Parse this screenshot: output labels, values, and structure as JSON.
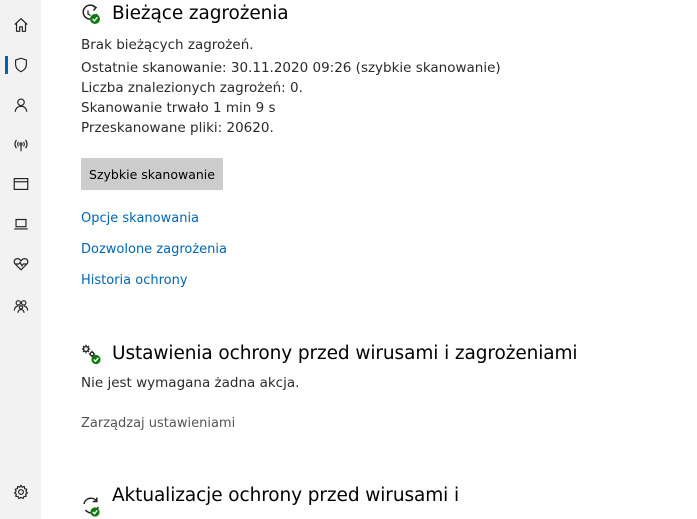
{
  "colors": {
    "accent": "#0063b1",
    "link": "#0066b4",
    "sidebar_bg": "#f2f2f2",
    "button_bg": "#cccccc",
    "status_ok": "#107c10"
  },
  "sidebar": {
    "items": [
      {
        "icon": "home-icon"
      },
      {
        "icon": "shield-icon",
        "active": true
      },
      {
        "icon": "person-icon"
      },
      {
        "icon": "wireless-icon"
      },
      {
        "icon": "app-browser-icon"
      },
      {
        "icon": "laptop-icon"
      },
      {
        "icon": "heart-icon"
      },
      {
        "icon": "family-icon"
      },
      {
        "icon": "gear-icon"
      }
    ]
  },
  "current_threats": {
    "icon": "scan-refresh-check-icon",
    "title": "Bieżące zagrożenia",
    "status": "Brak bieżących zagrożeń.",
    "last_scan": "Ostatnie skanowanie: 30.11.2020 09:26 (szybkie skanowanie)",
    "threats_found": "Liczba znalezionych zagrożeń: 0.",
    "scan_duration": "Skanowanie trwało 1 min 9 s",
    "files_scanned": "Przeskanowane pliki: 20620.",
    "quick_scan_label": "Szybkie skanowanie",
    "links": {
      "scan_options": "Opcje skanowania",
      "allowed_threats": "Dozwolone zagrożenia",
      "protection_history": "Historia ochrony"
    }
  },
  "protection_settings": {
    "icon": "gears-check-icon",
    "title": "Ustawienia ochrony przed wirusami i zagrożeniami",
    "status": "Nie jest wymagana żadna akcja.",
    "manage_label": "Zarządzaj ustawieniami"
  },
  "protection_updates": {
    "icon": "update-check-icon",
    "title": "Aktualizacje ochrony przed wirusami i"
  }
}
